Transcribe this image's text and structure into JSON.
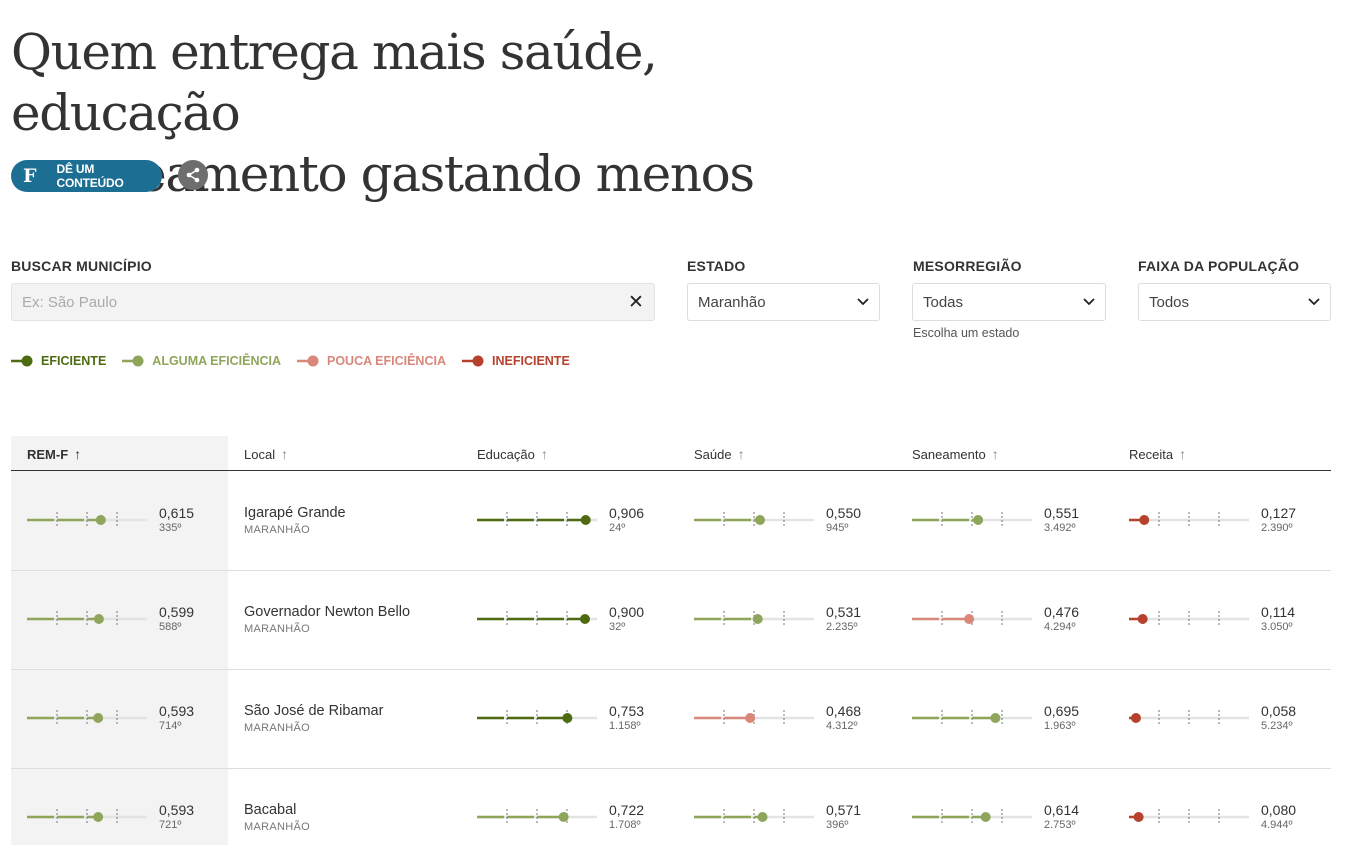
{
  "title_lines": [
    "Quem entrega mais saúde, educação",
    "e saneamento gastando menos"
  ],
  "buttons": {
    "folha_logo": "F",
    "give_content": "DÊ UM CONTEÚDO",
    "share_icon": "share-icon"
  },
  "filters": {
    "search": {
      "label": "BUSCAR MUNICÍPIO",
      "placeholder": "Ex: São Paulo",
      "value": "",
      "clear_icon": "✕"
    },
    "estado": {
      "label": "ESTADO",
      "value": "Maranhão"
    },
    "mesorregiao": {
      "label": "MESORREGIÃO",
      "value": "Todas",
      "hint": "Escolha um estado"
    },
    "faixa": {
      "label": "FAIXA DA POPULAÇÃO",
      "value": "Todos"
    },
    "chevron": "chevron-down-icon"
  },
  "colors": {
    "eficiente": "#4e6b12",
    "alguma": "#8fa55b",
    "pouca": "#d9877a",
    "ineficiente": "#b6412d",
    "track": "#e3e3e3"
  },
  "legend": [
    {
      "label": "EFICIENTE",
      "level": "eficiente"
    },
    {
      "label": "ALGUMA EFICIÊNCIA",
      "level": "alguma"
    },
    {
      "label": "POUCA EFICIÊNCIA",
      "level": "pouca"
    },
    {
      "label": "INEFICIENTE",
      "level": "ineficiente"
    }
  ],
  "table": {
    "headers": [
      "REM-F",
      "Local",
      "Educação",
      "Saúde",
      "Saneamento",
      "Receita"
    ],
    "sort_arrow": "↑",
    "rows": [
      {
        "city": "Igarapé Grande",
        "state": "MARANHÃO",
        "remf": {
          "value": "0,615",
          "rank": "335º",
          "level": "alguma",
          "pos": 0.615
        },
        "educacao": {
          "value": "0,906",
          "rank": "24º",
          "level": "eficiente",
          "pos": 0.906
        },
        "saude": {
          "value": "0,550",
          "rank": "945º",
          "level": "alguma",
          "pos": 0.55
        },
        "saneamento": {
          "value": "0,551",
          "rank": "3.492º",
          "level": "alguma",
          "pos": 0.551
        },
        "receita": {
          "value": "0,127",
          "rank": "2.390º",
          "level": "ineficiente",
          "pos": 0.127
        }
      },
      {
        "city": "Governador Newton Bello",
        "state": "MARANHÃO",
        "remf": {
          "value": "0,599",
          "rank": "588º",
          "level": "alguma",
          "pos": 0.599
        },
        "educacao": {
          "value": "0,900",
          "rank": "32º",
          "level": "eficiente",
          "pos": 0.9
        },
        "saude": {
          "value": "0,531",
          "rank": "2.235º",
          "level": "alguma",
          "pos": 0.531
        },
        "saneamento": {
          "value": "0,476",
          "rank": "4.294º",
          "level": "pouca",
          "pos": 0.476
        },
        "receita": {
          "value": "0,114",
          "rank": "3.050º",
          "level": "ineficiente",
          "pos": 0.114
        }
      },
      {
        "city": "São José de Ribamar",
        "state": "MARANHÃO",
        "remf": {
          "value": "0,593",
          "rank": "714º",
          "level": "alguma",
          "pos": 0.593
        },
        "educacao": {
          "value": "0,753",
          "rank": "1.158º",
          "level": "eficiente",
          "pos": 0.753
        },
        "saude": {
          "value": "0,468",
          "rank": "4.312º",
          "level": "pouca",
          "pos": 0.468
        },
        "saneamento": {
          "value": "0,695",
          "rank": "1.963º",
          "level": "alguma",
          "pos": 0.695
        },
        "receita": {
          "value": "0,058",
          "rank": "5.234º",
          "level": "ineficiente",
          "pos": 0.058
        }
      },
      {
        "city": "Bacabal",
        "state": "MARANHÃO",
        "remf": {
          "value": "0,593",
          "rank": "721º",
          "level": "alguma",
          "pos": 0.593
        },
        "educacao": {
          "value": "0,722",
          "rank": "1.708º",
          "level": "alguma",
          "pos": 0.722
        },
        "saude": {
          "value": "0,571",
          "rank": "396º",
          "level": "alguma",
          "pos": 0.571
        },
        "saneamento": {
          "value": "0,614",
          "rank": "2.753º",
          "level": "alguma",
          "pos": 0.614
        },
        "receita": {
          "value": "0,080",
          "rank": "4.944º",
          "level": "ineficiente",
          "pos": 0.08
        }
      }
    ]
  }
}
